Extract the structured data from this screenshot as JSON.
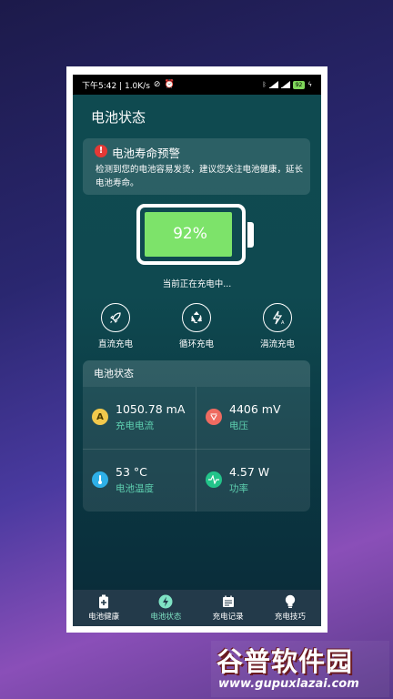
{
  "status_bar": {
    "time_speed": "下午5:42 | 1.0K/s",
    "battery_level": "92"
  },
  "header": {
    "title": "电池状态"
  },
  "warning": {
    "title": "电池寿命预警",
    "body": "检测到您的电池容易发烫，建议您关注电池健康，延长电池寿命。"
  },
  "battery": {
    "percent_label": "92%",
    "level": 92,
    "status": "当前正在充电中..."
  },
  "modes": [
    {
      "label": "直流充电",
      "icon": "rocket-icon"
    },
    {
      "label": "循环充电",
      "icon": "recycle-icon"
    },
    {
      "label": "涓流充电",
      "icon": "bolt-icon"
    }
  ],
  "panel": {
    "title": "电池状态",
    "metrics": [
      {
        "value": "1050.78 mA",
        "label": "充电电流",
        "icon": "current-icon",
        "color": "#f2c94c"
      },
      {
        "value": "4406 mV",
        "label": "电压",
        "icon": "voltage-icon",
        "color": "#ef6b61"
      },
      {
        "value": "53 °C",
        "label": "电池温度",
        "icon": "thermometer-icon",
        "color": "#2eb0e8"
      },
      {
        "value": "4.57 W",
        "label": "功率",
        "icon": "power-icon",
        "color": "#23c48a"
      }
    ]
  },
  "tabs": [
    {
      "label": "电池健康",
      "icon": "battery-plus-icon",
      "active": false
    },
    {
      "label": "电池状态",
      "icon": "bolt-circle-icon",
      "active": true
    },
    {
      "label": "充电记录",
      "icon": "calendar-icon",
      "active": false
    },
    {
      "label": "充电技巧",
      "icon": "bulb-icon",
      "active": false
    }
  ],
  "watermark": {
    "brand": "谷普软件园",
    "url": "www.gupuxlazai.com"
  }
}
